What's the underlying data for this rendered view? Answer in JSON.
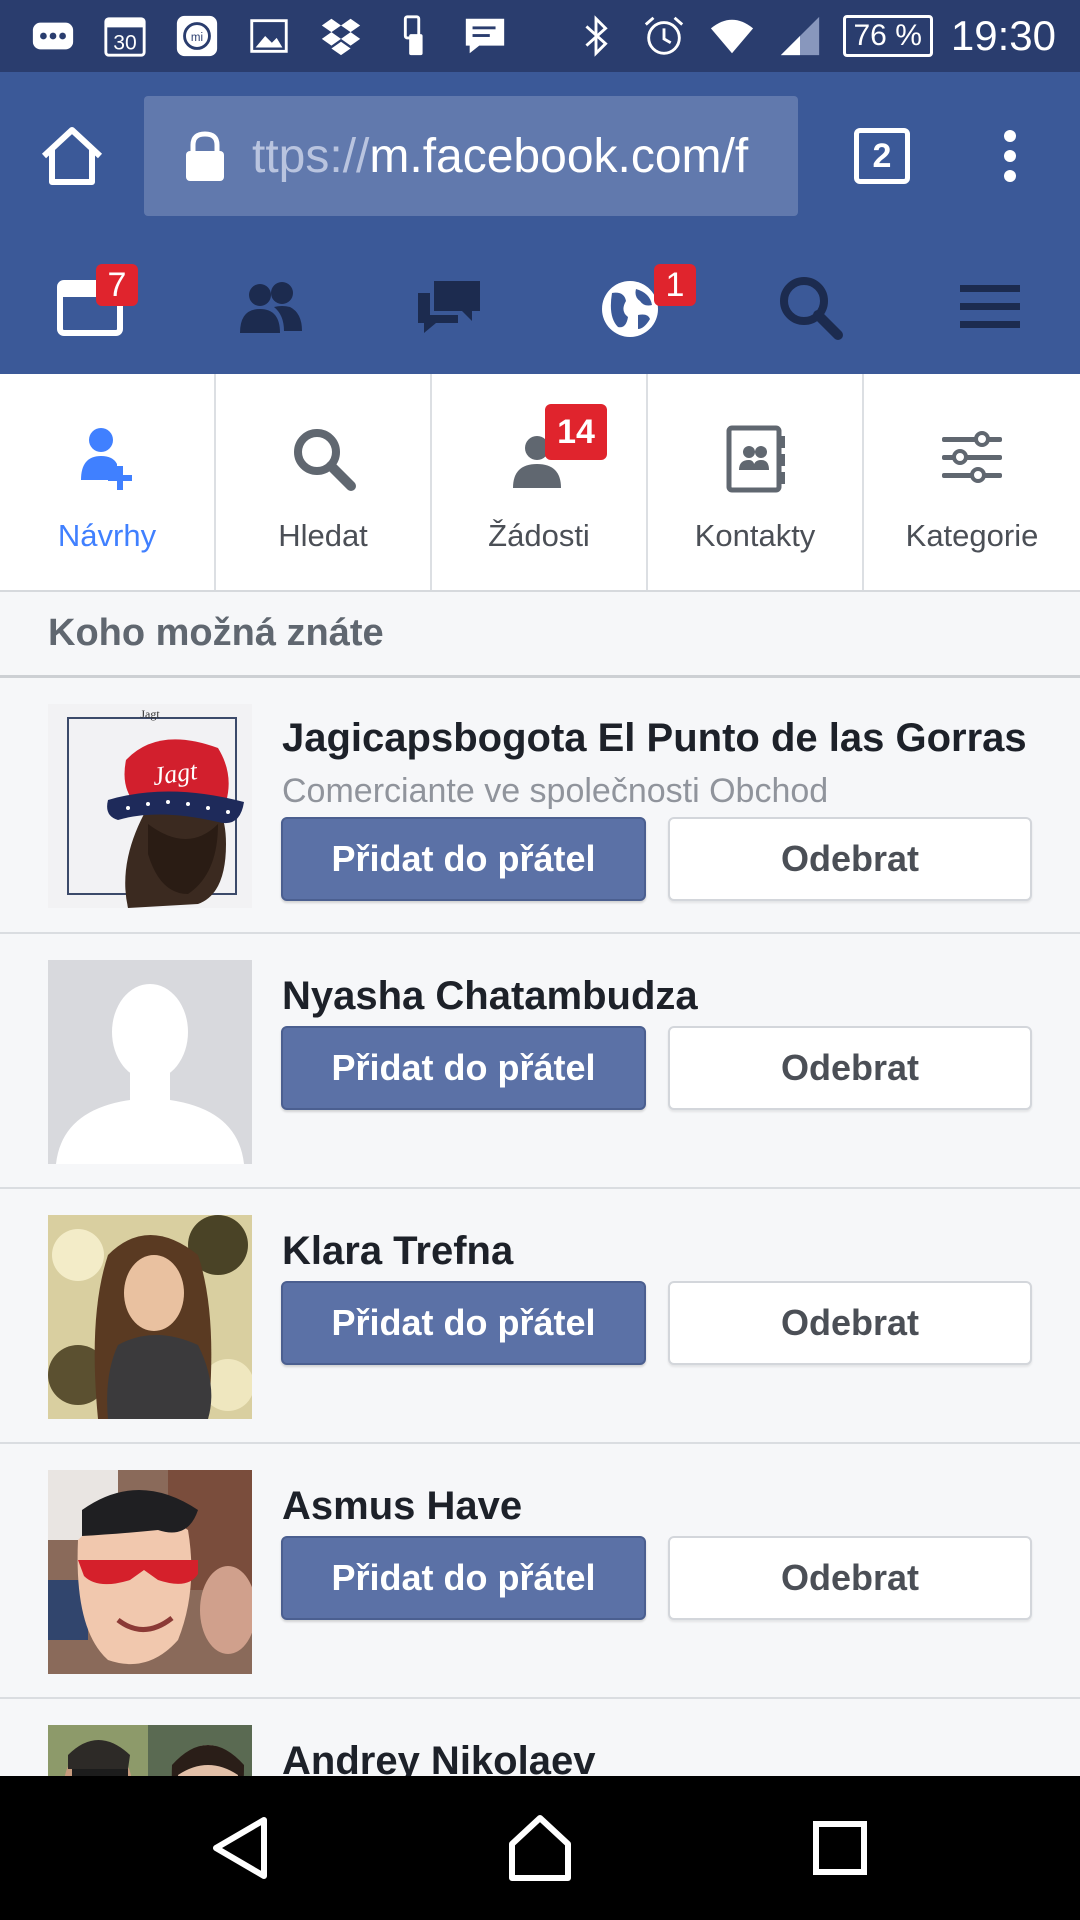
{
  "status_bar": {
    "icons": [
      "more-notifications-icon",
      "calendar-30-icon",
      "mi-fit-icon",
      "image-icon",
      "dropbox-icon",
      "phone-sync-icon",
      "message-icon",
      "bluetooth-icon",
      "alarm-icon",
      "wifi-icon",
      "signal-icon"
    ],
    "calendar_day": "30",
    "battery": "76 %",
    "time": "19:30"
  },
  "browser": {
    "url_prefix": "ttps://",
    "url_main": "m.facebook.com/f",
    "tab_count": "2"
  },
  "fb_nav": {
    "items": [
      {
        "icon": "news-feed-icon",
        "badge": "7"
      },
      {
        "icon": "friends-icon",
        "badge": ""
      },
      {
        "icon": "messages-icon",
        "badge": ""
      },
      {
        "icon": "notifications-globe-icon",
        "badge": "1"
      },
      {
        "icon": "search-icon",
        "badge": ""
      },
      {
        "icon": "menu-icon",
        "badge": ""
      }
    ],
    "accent": "#3b5998"
  },
  "sub_tabs": {
    "items": [
      {
        "label": "Návrhy",
        "icon": "add-friend-icon",
        "active": true
      },
      {
        "label": "Hledat",
        "icon": "search-icon"
      },
      {
        "label": "Žádosti",
        "icon": "friend-requests-icon",
        "badge": "14"
      },
      {
        "label": "Kontakty",
        "icon": "contacts-icon"
      },
      {
        "label": "Kategorie",
        "icon": "sliders-icon"
      }
    ],
    "active_color": "#4080ff"
  },
  "section": {
    "title": "Koho možná znáte"
  },
  "people": [
    {
      "name": "Jagicapsbogota El Punto de las Gorras",
      "subtitle": "Comerciante ve společnosti Obchod",
      "add_label": "Přidat do přátel",
      "remove_label": "Odebrat",
      "cap_text": "Jagt",
      "watermark": "Jagt"
    },
    {
      "name": "Nyasha Chatambudza",
      "subtitle": "",
      "add_label": "Přidat do přátel",
      "remove_label": "Odebrat"
    },
    {
      "name": "Klara Trefna",
      "subtitle": "",
      "add_label": "Přidat do přátel",
      "remove_label": "Odebrat"
    },
    {
      "name": "Asmus Have",
      "subtitle": "",
      "add_label": "Přidat do přátel",
      "remove_label": "Odebrat"
    },
    {
      "name": "Andrey Nikolaev",
      "subtitle": ""
    }
  ],
  "system_nav": {
    "icons": [
      "back-icon",
      "home-icon",
      "recents-icon"
    ]
  }
}
